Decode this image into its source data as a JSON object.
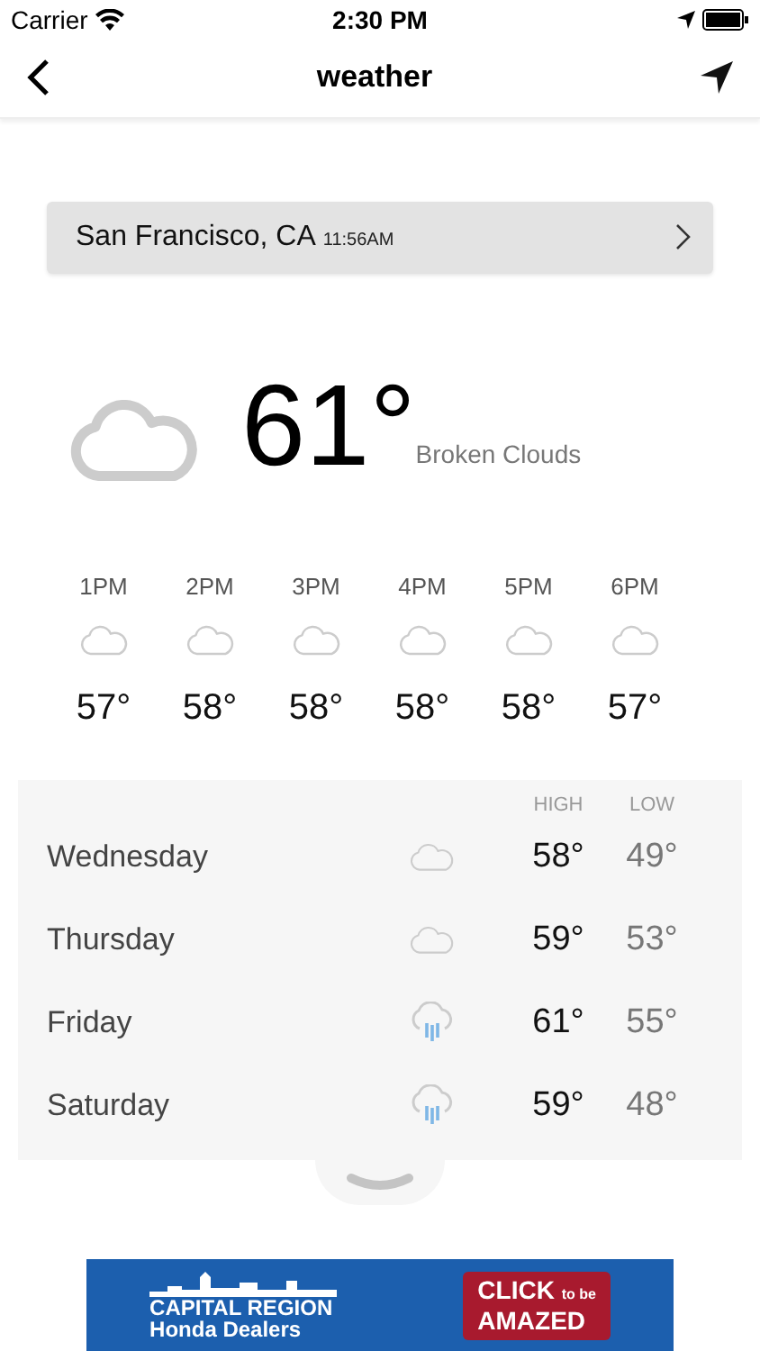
{
  "status_bar": {
    "carrier": "Carrier",
    "time": "2:30 PM"
  },
  "nav": {
    "title": "weather"
  },
  "location": {
    "city": "San Francisco, CA",
    "time": "11:56AM"
  },
  "current": {
    "temperature": "61°",
    "condition": "Broken Clouds"
  },
  "hourly": [
    {
      "time": "1PM",
      "temp": "57°"
    },
    {
      "time": "2PM",
      "temp": "58°"
    },
    {
      "time": "3PM",
      "temp": "58°"
    },
    {
      "time": "4PM",
      "temp": "58°"
    },
    {
      "time": "5PM",
      "temp": "58°"
    },
    {
      "time": "6PM",
      "temp": "57°"
    }
  ],
  "forecast": {
    "high_label": "HIGH",
    "low_label": "LOW",
    "days": [
      {
        "day": "Wednesday",
        "kind": "cloud",
        "high": "58°",
        "low": "49°"
      },
      {
        "day": "Thursday",
        "kind": "cloud",
        "high": "59°",
        "low": "53°"
      },
      {
        "day": "Friday",
        "kind": "rain",
        "high": "61°",
        "low": "55°"
      },
      {
        "day": "Saturday",
        "kind": "rain",
        "high": "59°",
        "low": "48°"
      }
    ]
  },
  "ad": {
    "line_1": "CAPITAL REGION",
    "line_2": "Honda Dealers",
    "button_1": "CLICK",
    "button_small": "to be",
    "button_2": "AMAZED"
  }
}
